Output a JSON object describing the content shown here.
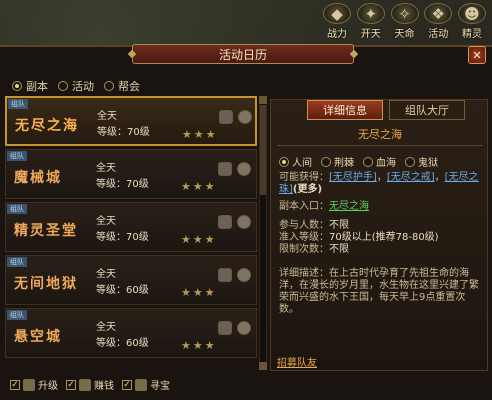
{
  "topbar": {
    "buttons": [
      {
        "label": "战力",
        "icon": "gem-icon"
      },
      {
        "label": "开天",
        "icon": "heaven-icon"
      },
      {
        "label": "天命",
        "icon": "fate-icon"
      },
      {
        "label": "活动",
        "icon": "activity-icon"
      },
      {
        "label": "精灵",
        "icon": "spirit-icon"
      }
    ]
  },
  "window": {
    "title": "活动日历",
    "close": "✕"
  },
  "filters": [
    {
      "label": "副本",
      "selected": true
    },
    {
      "label": "活动",
      "selected": false
    },
    {
      "label": "帮会",
      "selected": false
    }
  ],
  "dungeons": [
    {
      "badge": "组队",
      "name": "无尽之海",
      "time": "全天",
      "level": "等级：70级",
      "stars": "★★★",
      "selected": true
    },
    {
      "badge": "组队",
      "name": "魔械城",
      "time": "全天",
      "level": "等级：70级",
      "stars": "★★★",
      "selected": false
    },
    {
      "badge": "组队",
      "name": "精灵圣堂",
      "time": "全天",
      "level": "等级：70级",
      "stars": "★★★",
      "selected": false
    },
    {
      "badge": "组队",
      "name": "无间地狱",
      "time": "全天",
      "level": "等级：60级",
      "stars": "★★★",
      "selected": false
    },
    {
      "badge": "组队",
      "name": "悬空城",
      "time": "全天",
      "level": "等级：60级",
      "stars": "★★★",
      "selected": false
    }
  ],
  "detail": {
    "tabs": [
      "详细信息",
      "组队大厅"
    ],
    "title": "无尽之海",
    "modes": [
      "人间",
      "荆棘",
      "血海",
      "鬼狱"
    ],
    "rewards_label": "可能获得：",
    "rewards": [
      "[无尽护手]",
      "[无尽之戒]",
      "[无尽之珠]"
    ],
    "rewards_more": "(更多)",
    "entry_label": "副本入口：",
    "entry_value": "无尽之海",
    "participants_label": "参与人数：",
    "participants_value": "不限",
    "level_req_label": "准入等级：",
    "level_req_value": "70级以上(推荐78-80级)",
    "limit_label": "限制次数：",
    "limit_value": "不限",
    "desc_label": "详细描述：",
    "desc_text": "在上古时代孕育了先祖生命的海洋，在漫长的岁月里，水生物在这里兴建了繁荣而兴盛的水下王国，每天早上9点重置次数。",
    "recruit": "招募队友"
  },
  "bottom": [
    {
      "label": "升级",
      "checked": true
    },
    {
      "label": "赚钱",
      "checked": true
    },
    {
      "label": "寻宝",
      "checked": true
    }
  ]
}
